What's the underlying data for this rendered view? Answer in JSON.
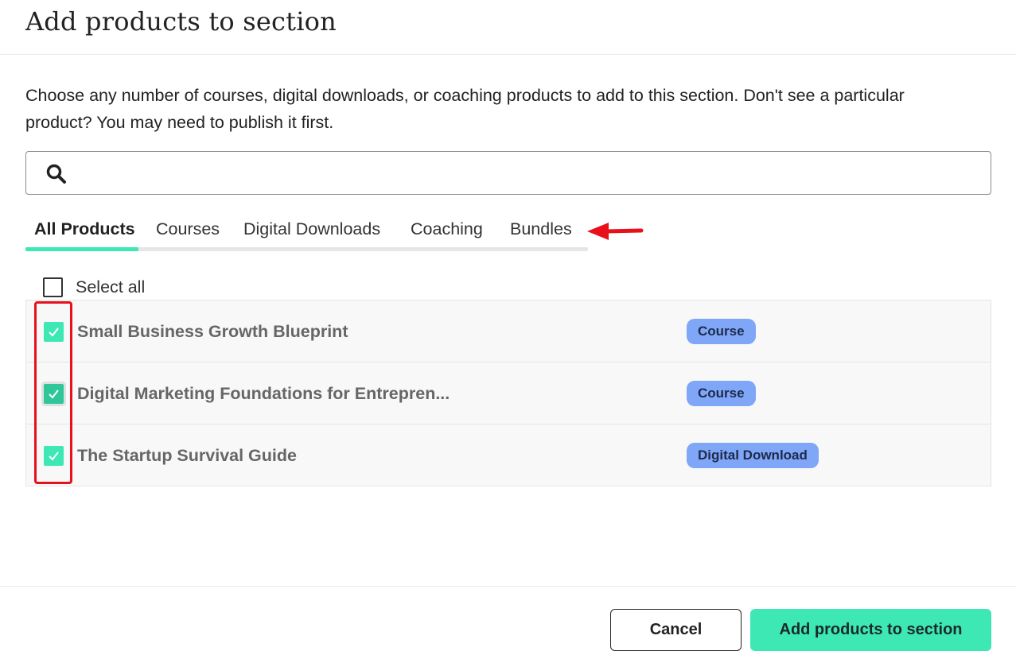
{
  "dialog": {
    "title": "Add products to section",
    "description": "Choose any number of courses, digital downloads, or coaching products to add to this section. Don't see a particular product? You may need to publish it first."
  },
  "search": {
    "placeholder": "",
    "value": "",
    "icon": "search-icon"
  },
  "tabs": [
    {
      "label": "All Products",
      "active": true
    },
    {
      "label": "Courses",
      "active": false
    },
    {
      "label": "Digital Downloads",
      "active": false
    },
    {
      "label": "Coaching",
      "active": false
    },
    {
      "label": "Bundles",
      "active": false
    }
  ],
  "select_all": {
    "label": "Select all",
    "checked": false
  },
  "products": [
    {
      "name": "Small Business Growth Blueprint",
      "type": "Course",
      "checked": true
    },
    {
      "name": "Digital Marketing Foundations for Entrepren...",
      "type": "Course",
      "checked": true
    },
    {
      "name": "The Startup Survival Guide",
      "type": "Digital Download",
      "checked": true
    }
  ],
  "buttons": {
    "cancel": "Cancel",
    "add": "Add products to section"
  },
  "colors": {
    "accent": "#3ee8b5",
    "badge": "#7fa6f7",
    "annotation": "#e8101b"
  }
}
